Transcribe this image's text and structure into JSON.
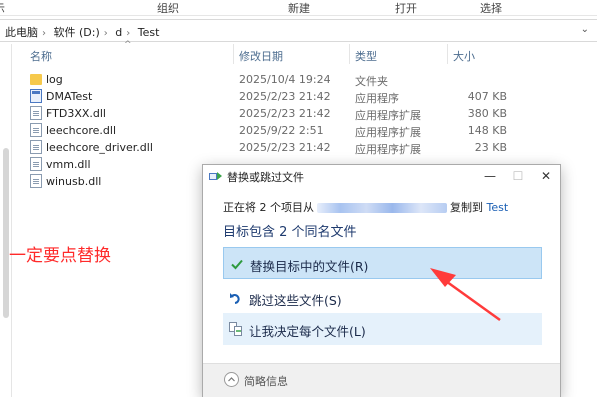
{
  "ribbon": {
    "labels": [
      "组织",
      "新建",
      "打开",
      "选择"
    ]
  },
  "address_bar": {
    "crumbs": [
      "此电脑",
      "软件 (D:)",
      "d",
      "Test"
    ]
  },
  "columns": {
    "name": "名称",
    "date": "修改日期",
    "type": "类型",
    "size": "大小"
  },
  "files": [
    {
      "name": "log",
      "date": "2025/10/4 19:24",
      "type": "文件夹",
      "size": "",
      "icon": "folder-icon"
    },
    {
      "name": "DMATest",
      "date": "2025/2/23 21:42",
      "type": "应用程序",
      "size": "407 KB",
      "icon": "application-icon"
    },
    {
      "name": "FTD3XX.dll",
      "date": "2025/2/23 21:42",
      "type": "应用程序扩展",
      "size": "380 KB",
      "icon": "dll-file-icon"
    },
    {
      "name": "leechcore.dll",
      "date": "2025/9/22 2:51",
      "type": "应用程序扩展",
      "size": "148 KB",
      "icon": "dll-file-icon"
    },
    {
      "name": "leechcore_driver.dll",
      "date": "2025/2/23 21:42",
      "type": "应用程序扩展",
      "size": "23 KB",
      "icon": "dll-file-icon"
    },
    {
      "name": "vmm.dll",
      "date": "",
      "type": "",
      "size": "",
      "icon": "dll-file-icon"
    },
    {
      "name": "winusb.dll",
      "date": "",
      "type": "",
      "size": "",
      "icon": "dll-file-icon"
    }
  ],
  "annotation": {
    "text": "一定要点替换",
    "color": "#ff2a2a"
  },
  "dialog": {
    "title": "替换或跳过文件",
    "controls": {
      "minimize": "—",
      "maximize": "☐",
      "close": "✕"
    },
    "progress_prefix": "正在将 2 个项目从",
    "progress_middle": "复制到",
    "destination": "Test",
    "heading": "目标包含 2 个同名文件",
    "options": {
      "replace": "替换目标中的文件(R)",
      "skip": "跳过这些文件(S)",
      "decide": "让我决定每个文件(L)"
    },
    "footer": "简略信息"
  },
  "colors": {
    "accent": "#1a5fb4",
    "selected_option": "#cce4f7",
    "folder": "#f6c94c"
  }
}
